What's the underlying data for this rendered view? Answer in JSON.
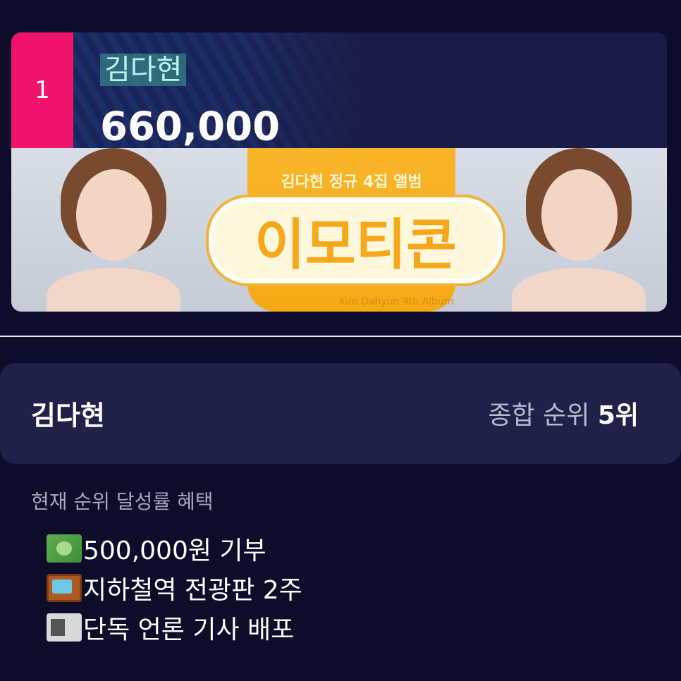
{
  "rank_card": {
    "rank": "1",
    "artist_name": "김다현",
    "votes": "660,000",
    "banner": {
      "subtitle": "김다현 정규 4집 앨범",
      "title": "이모티콘",
      "footer": "Kim Dahyun 4th Album"
    }
  },
  "info_card": {
    "artist_name": "김다현",
    "overall_rank_label": "종합 순위",
    "overall_rank_value": "5위"
  },
  "benefits": {
    "heading": "현재 순위 달성률 혜택",
    "items": [
      {
        "icon": "money-icon",
        "text": "500,000원 기부"
      },
      {
        "icon": "tv-icon",
        "text": "지하철역 전광판 2주"
      },
      {
        "icon": "newspaper-icon",
        "text": "단독 언론 기사 배포"
      }
    ]
  }
}
